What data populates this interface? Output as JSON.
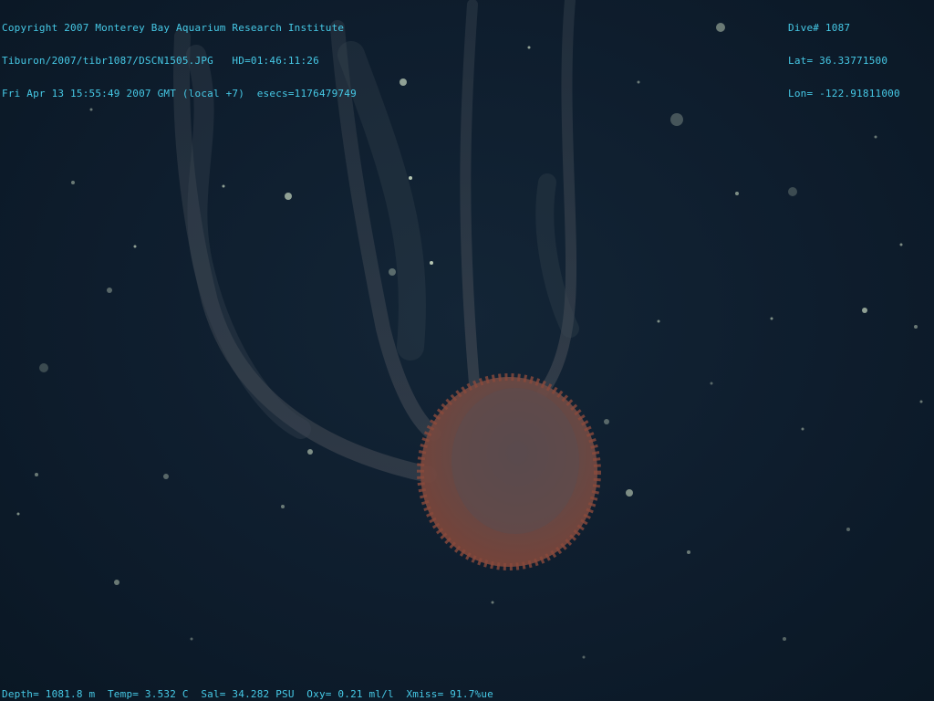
{
  "overlay": {
    "top_left": [
      "Copyright 2007 Monterey Bay Aquarium Research Institute",
      "Tiburon/2007/tibr1087/DSCN1505.JPG   HD=01:46:11:26",
      "Fri Apr 13 15:55:49 2007 GMT (local +7)  esecs=1176479749"
    ],
    "top_right": [
      "Dive# 1087",
      "Lat= 36.33771500",
      "Lon= -122.91811000"
    ],
    "bottom": "Depth= 1081.8 m  Temp= 3.532 C  Sal= 34.282 PSU  Oxy= 0.21 ml/l  Xmiss= 91.7%ue"
  },
  "colors": {
    "overlay_text": "#46c9e6",
    "water": "#0e1d2d",
    "bell": "#7a5048"
  },
  "scene": {
    "subject": "jellyfish-bell-with-oral-arms"
  }
}
